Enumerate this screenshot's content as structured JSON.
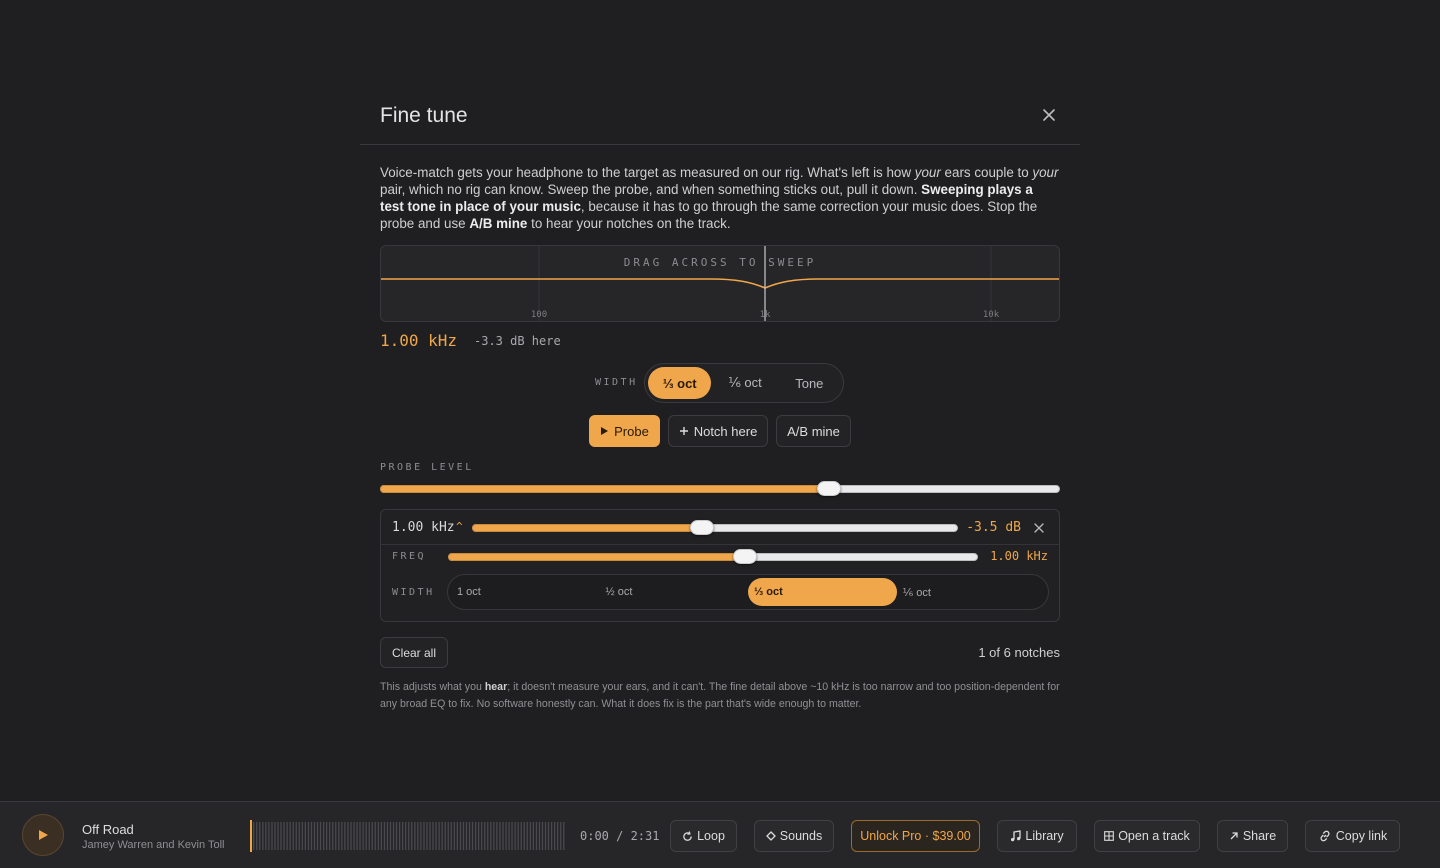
{
  "modal": {
    "title": "Fine tune",
    "intro": {
      "p1": "Voice-match gets your headphone to the target as measured on our rig. What's left is how ",
      "p1_em": "your",
      "p2": " ears couple to ",
      "p2_em": "your",
      "p3": " pair, which no rig can know. Sweep the probe, and when something sticks out, pull it down. ",
      "p3_b": "Sweeping plays a test tone in place of your music",
      "p4": ", because it has to go through the same correction your music does. Stop the probe and use ",
      "p4_b": "A/B mine",
      "p5": " to hear your notches on the track."
    },
    "sweep": {
      "hint": "DRAG ACROSS TO SWEEP",
      "ticks": [
        "100",
        "1k",
        "10k"
      ],
      "cursor_freq_hz": 1000,
      "notch_db": -3.3
    },
    "readout": {
      "freq": "1.00 kHz",
      "db": "-3.3 dB here"
    },
    "width": {
      "label": "WIDTH",
      "options": [
        "⅓ oct",
        "⅙ oct",
        "Tone"
      ],
      "selected": 0
    },
    "actions": {
      "probe": "Probe",
      "notch_here": "Notch here",
      "ab_mine": "A/B mine"
    },
    "probe_level": {
      "label": "PROBE LEVEL",
      "value": 0.66
    },
    "notch": {
      "freq": "1.00 kHz",
      "caret": "^",
      "gain": "-3.5 dB",
      "gain_value": 0.474,
      "freq_label": "FREQ",
      "freq_value_text": "1.00 kHz",
      "freq_value": 0.56,
      "width_label": "WIDTH",
      "width_options": [
        "1 oct",
        "½ oct",
        "⅓ oct",
        "⅙ oct"
      ],
      "width_selected": 2
    },
    "clear_all": "Clear all",
    "count": "1 of 6 notches",
    "footnote": {
      "a": "This adjusts what you ",
      "b": "hear",
      "c": "; it doesn't measure your ears, and it can't. The fine detail above ~10 kHz is too narrow and too position-dependent for any broad EQ to fix. No software honestly can. What it does fix is the part that's wide enough to matter."
    }
  },
  "player": {
    "title": "Off Road",
    "artist": "Jamey Warren and Kevin Toll",
    "time": "0:00  /  2:31",
    "progress": 0,
    "buttons": {
      "loop": "Loop",
      "sounds": "Sounds",
      "unlock": "Unlock Pro · $39.00",
      "library": "Library",
      "open": "Open a track",
      "share": "Share",
      "copy": "Copy link"
    }
  },
  "colors": {
    "accent": "#f0a64a",
    "background": "#1f1f21",
    "panel": "#262628"
  }
}
